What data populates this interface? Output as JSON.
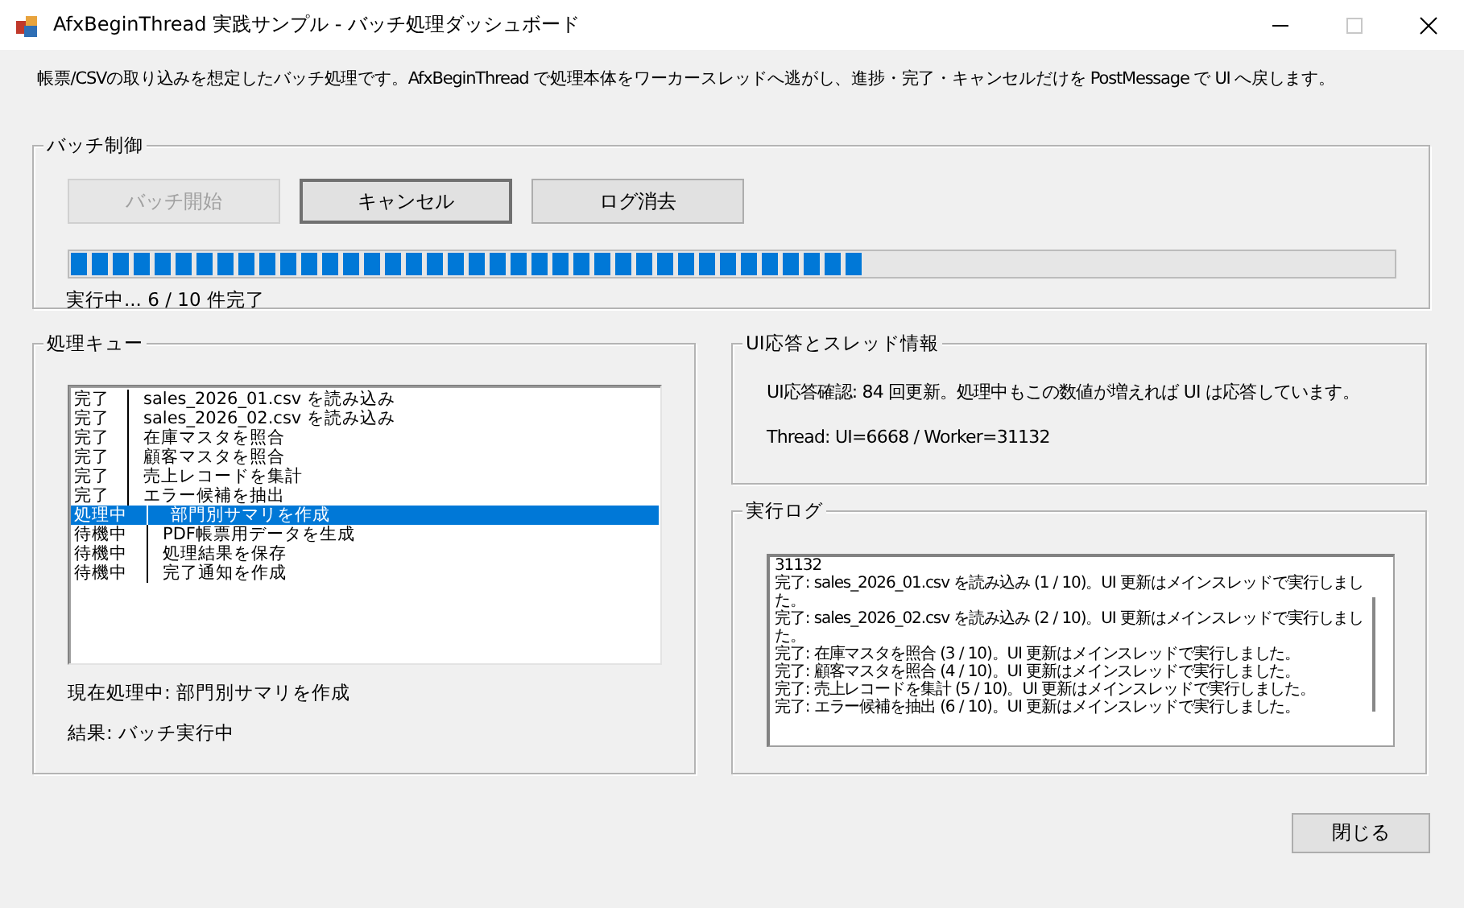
{
  "window": {
    "title": "AfxBeginThread 実践サンプル - バッチ処理ダッシュボード"
  },
  "description": "帳票/CSVの取り込みを想定したバッチ処理です。AfxBeginThread で処理本体をワーカースレッドへ逃がし、進捗・完了・キャンセルだけを PostMessage で UI へ戻します。",
  "batch_control": {
    "title": "バッチ制御",
    "buttons": [
      {
        "label": "バッチ開始",
        "disabled": true
      },
      {
        "label": "キャンセル",
        "disabled": false
      },
      {
        "label": "ログ消去",
        "disabled": false
      }
    ],
    "progress": {
      "level": 0.6
    },
    "status": "実行中... 6 / 10 件完了"
  },
  "queue": {
    "title": "処理キュー",
    "items": [
      {
        "status": "完了",
        "task": "sales_2026_01.csv を読み込み",
        "selected": false
      },
      {
        "status": "完了",
        "task": "sales_2026_02.csv を読み込み",
        "selected": false
      },
      {
        "status": "完了",
        "task": "在庫マスタを照合",
        "selected": false
      },
      {
        "status": "完了",
        "task": "顧客マスタを照合",
        "selected": false
      },
      {
        "status": "完了",
        "task": "売上レコードを集計",
        "selected": false
      },
      {
        "status": "完了",
        "task": "エラー候補を抽出",
        "selected": false
      },
      {
        "status": "処理中",
        "task": "部門別サマリを作成",
        "selected": true
      },
      {
        "status": "待機中",
        "task": "PDF帳票用データを生成",
        "selected": false
      },
      {
        "status": "待機中",
        "task": "処理結果を保存",
        "selected": false
      },
      {
        "status": "待機中",
        "task": "完了通知を作成",
        "selected": false
      }
    ],
    "current": "現在処理中: 部門別サマリを作成",
    "result": "結果: バッチ実行中"
  },
  "ui_info": {
    "title": "UI応答とスレッド情報",
    "heartbeat": "UI応答確認: 84 回更新。処理中もこの数値が増えれば UI は応答しています。",
    "thread": "Thread: UI=6668 / Worker=31132"
  },
  "log": {
    "title": "実行ログ",
    "lines": [
      "31132",
      "完了: sales_2026_01.csv を読み込み (1 / 10)。UI 更新はメインスレッドで実行しました。",
      "完了: sales_2026_02.csv を読み込み (2 / 10)。UI 更新はメインスレッドで実行しました。",
      "完了: 在庫マスタを照合 (3 / 10)。UI 更新はメインスレッドで実行しました。",
      "完了: 顧客マスタを照合 (4 / 10)。UI 更新はメインスレッドで実行しました。",
      "完了: 売上レコードを集計 (5 / 10)。UI 更新はメインスレッドで実行しました。",
      "完了: エラー候補を抽出 (6 / 10)。UI 更新はメインスレッドで実行しました。"
    ]
  },
  "close_button": {
    "label": "閉じる"
  }
}
